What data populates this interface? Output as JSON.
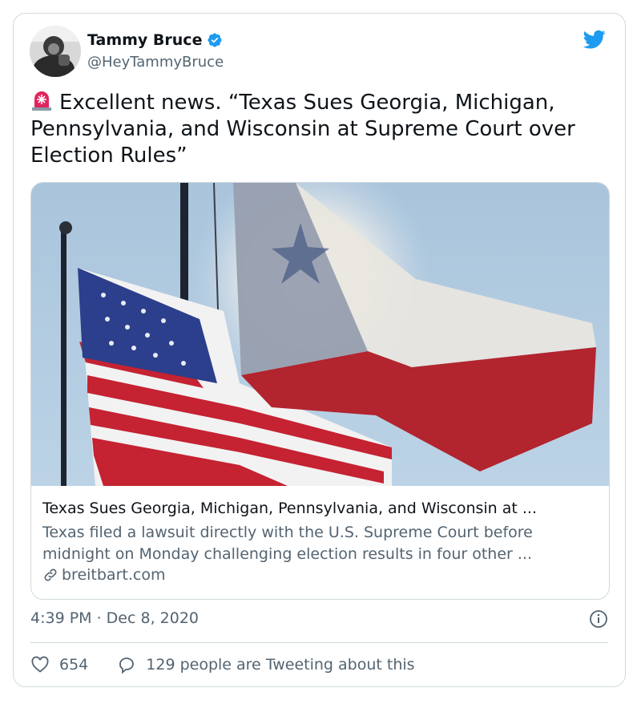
{
  "author": {
    "name": "Tammy Bruce",
    "handle": "@HeyTammyBruce",
    "verified": true
  },
  "tweet": {
    "emoji": "rotating-light-emoji",
    "text": "Excellent news. “Texas Sues Georgia, Michigan, Pennsylvania, and Wisconsin at Supreme Court over Election Rules”"
  },
  "link_card": {
    "title": "Texas Sues Georgia, Michigan, Pennsylvania, and Wisconsin at ...",
    "description": "Texas filed a lawsuit directly with the U.S. Supreme Court before midnight on Monday challenging election results in four other ...",
    "domain": "breitbart.com"
  },
  "meta": {
    "timestamp": "4:39 PM · Dec 8, 2020"
  },
  "actions": {
    "likes": "654",
    "conversation": "129 people are Tweeting about this"
  },
  "colors": {
    "brand": "#1d9bf0",
    "secondary_text": "#536471",
    "border": "#cfd9de"
  }
}
